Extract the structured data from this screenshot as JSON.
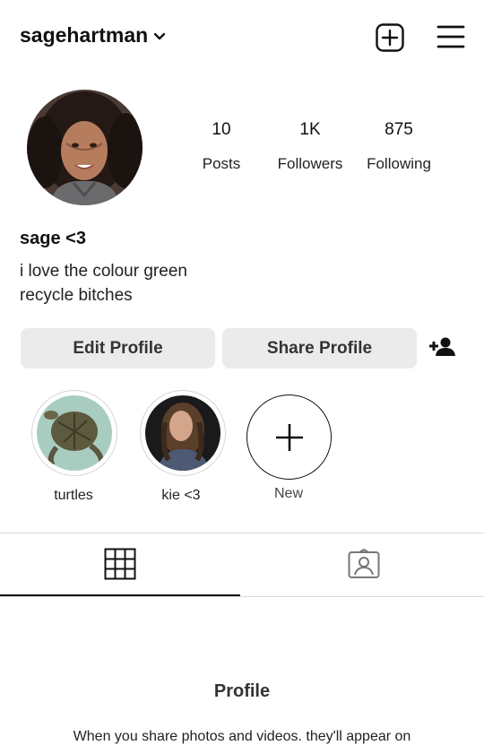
{
  "header": {
    "username": "sagehartman",
    "icons": {
      "dropdown": "chevron-down-icon",
      "create": "plus-square-icon",
      "menu": "hamburger-menu-icon"
    }
  },
  "profile": {
    "display_name": "sage <3",
    "bio_lines": [
      "i love the colour green",
      "recycle bitches"
    ],
    "stats": [
      {
        "value": "10",
        "label": "Posts"
      },
      {
        "value": "1K",
        "label": "Followers"
      },
      {
        "value": "875",
        "label": "Following"
      }
    ]
  },
  "actions": {
    "edit_label": "Edit Profile",
    "share_label": "Share Profile",
    "add_person_icon": "add-person-icon"
  },
  "highlights": [
    {
      "label": "turtles"
    },
    {
      "label": "kie <3"
    },
    {
      "label": "New"
    }
  ],
  "tabs": {
    "grid_icon": "grid-icon",
    "tagged_icon": "tagged-person-icon",
    "active": "grid"
  },
  "empty_state": {
    "title": "Profile",
    "text": "When you share photos and videos. they'll appear on"
  },
  "colors": {
    "button_bg": "#ebebeb",
    "divider": "#dbdbdb",
    "text": "#111111"
  }
}
